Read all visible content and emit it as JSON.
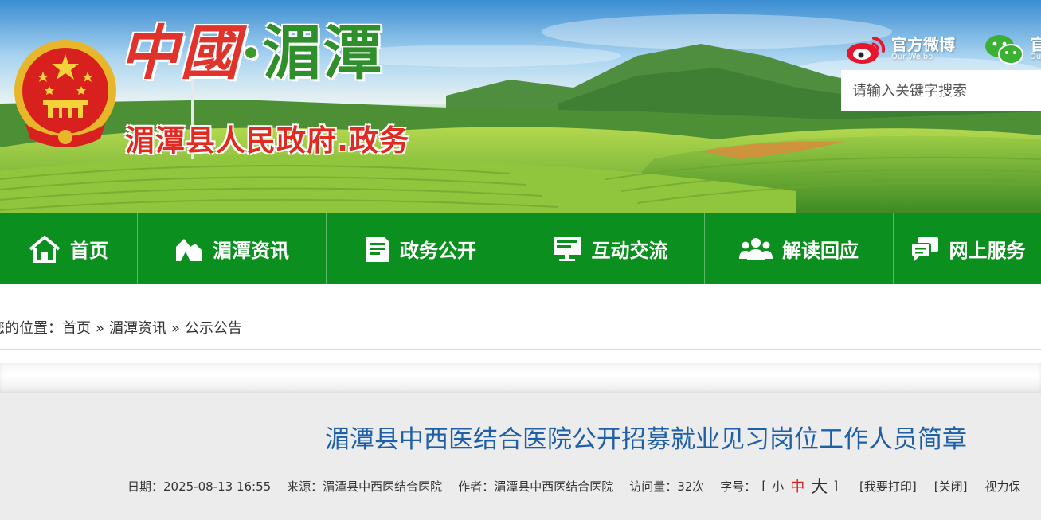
{
  "header": {
    "logo_part1": "中國",
    "logo_dot": "·",
    "logo_part2": "湄潭",
    "subtitle": "湄潭县人民政府.政务",
    "weibo_label": "官方微博",
    "weibo_sub": "Our Weibo",
    "wechat_label": "官",
    "wechat_sub": "Ou",
    "search_placeholder": "请输入关键字搜索"
  },
  "nav": [
    {
      "label": "首页",
      "icon": "home-icon"
    },
    {
      "label": "湄潭资讯",
      "icon": "news-icon"
    },
    {
      "label": "政务公开",
      "icon": "document-icon"
    },
    {
      "label": "互动交流",
      "icon": "monitor-icon"
    },
    {
      "label": "解读回应",
      "icon": "users-icon"
    },
    {
      "label": "网上服务",
      "icon": "chat-icon"
    }
  ],
  "breadcrumb": {
    "prefix": "您的位置：",
    "items": [
      "首页",
      "湄潭资讯",
      "公示公告"
    ],
    "separator": "»"
  },
  "article": {
    "title": "湄潭县中西医结合医院公开招募就业见习岗位工作人员简章",
    "date": "日期：2025-08-13 16:55",
    "source": "来源：湄潭县中西医结合医院",
    "author": "作者：湄潭县中西医结合医院",
    "visits": "访问量：32次",
    "font_label": "字号：",
    "bracket_open": "[",
    "font_small": "小",
    "font_medium": "中",
    "font_large": "大",
    "bracket_close": "]",
    "print": "[我要打印]",
    "close": "[关闭]",
    "vision": "视力保"
  },
  "colors": {
    "nav_green": "#0b8f1f",
    "title_blue": "#1e5fa8",
    "logo_red": "#e12a22",
    "logo_green": "#2f8f2a"
  }
}
